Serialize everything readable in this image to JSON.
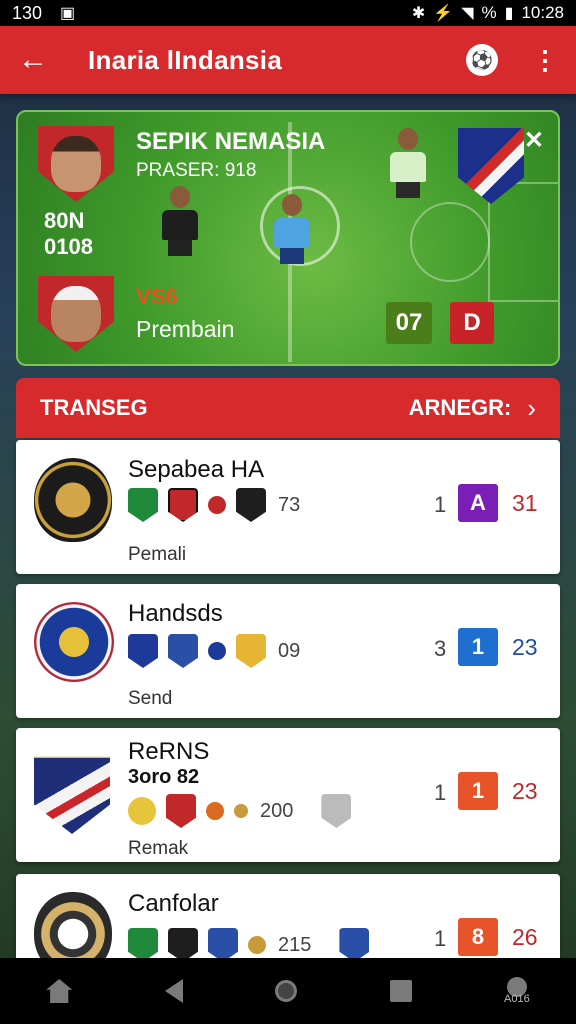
{
  "status": {
    "time_left": "130",
    "time_right": "10:28",
    "battery_text": "%"
  },
  "appbar": {
    "title": "Inaria lIndansia"
  },
  "hero": {
    "title": "SEPIK NEMASIA",
    "subtitle": "PRASER: 918",
    "score_a": "80N",
    "score_b": "0108",
    "vs_label": "VS6",
    "footer": "Prembain",
    "badge_left": "07",
    "badge_right": "D"
  },
  "list": {
    "header_left": "TRANSEG",
    "header_right": "ARNEGR:",
    "rows": [
      {
        "name": "Sepabea HA",
        "name2": "",
        "code": "73",
        "sub": "Pemali",
        "rank": "1",
        "pill": "A",
        "pill_color": "#7a1fb5",
        "pts": "31",
        "pts_color": "#c0282a"
      },
      {
        "name": "Handsds",
        "name2": "",
        "code": "09",
        "sub": "Send",
        "rank": "3",
        "pill": "1",
        "pill_color": "#1e6fd0",
        "pts": "23",
        "pts_color": "#1e4fa0"
      },
      {
        "name": "ReRNS",
        "name2": "3oro 82",
        "code": "200",
        "sub": "Remak",
        "rank": "1",
        "pill": "1",
        "pill_color": "#e8542a",
        "pts": "23",
        "pts_color": "#c0282a"
      },
      {
        "name": "Canfolar",
        "name2": "",
        "code": "215",
        "sub": "",
        "rank": "1",
        "pill": "8",
        "pill_color": "#e8542a",
        "pts": "26",
        "pts_color": "#c0282a"
      }
    ]
  },
  "nav": {
    "profile_label": "A016"
  },
  "colors": {
    "brand": "#d62a2c"
  }
}
